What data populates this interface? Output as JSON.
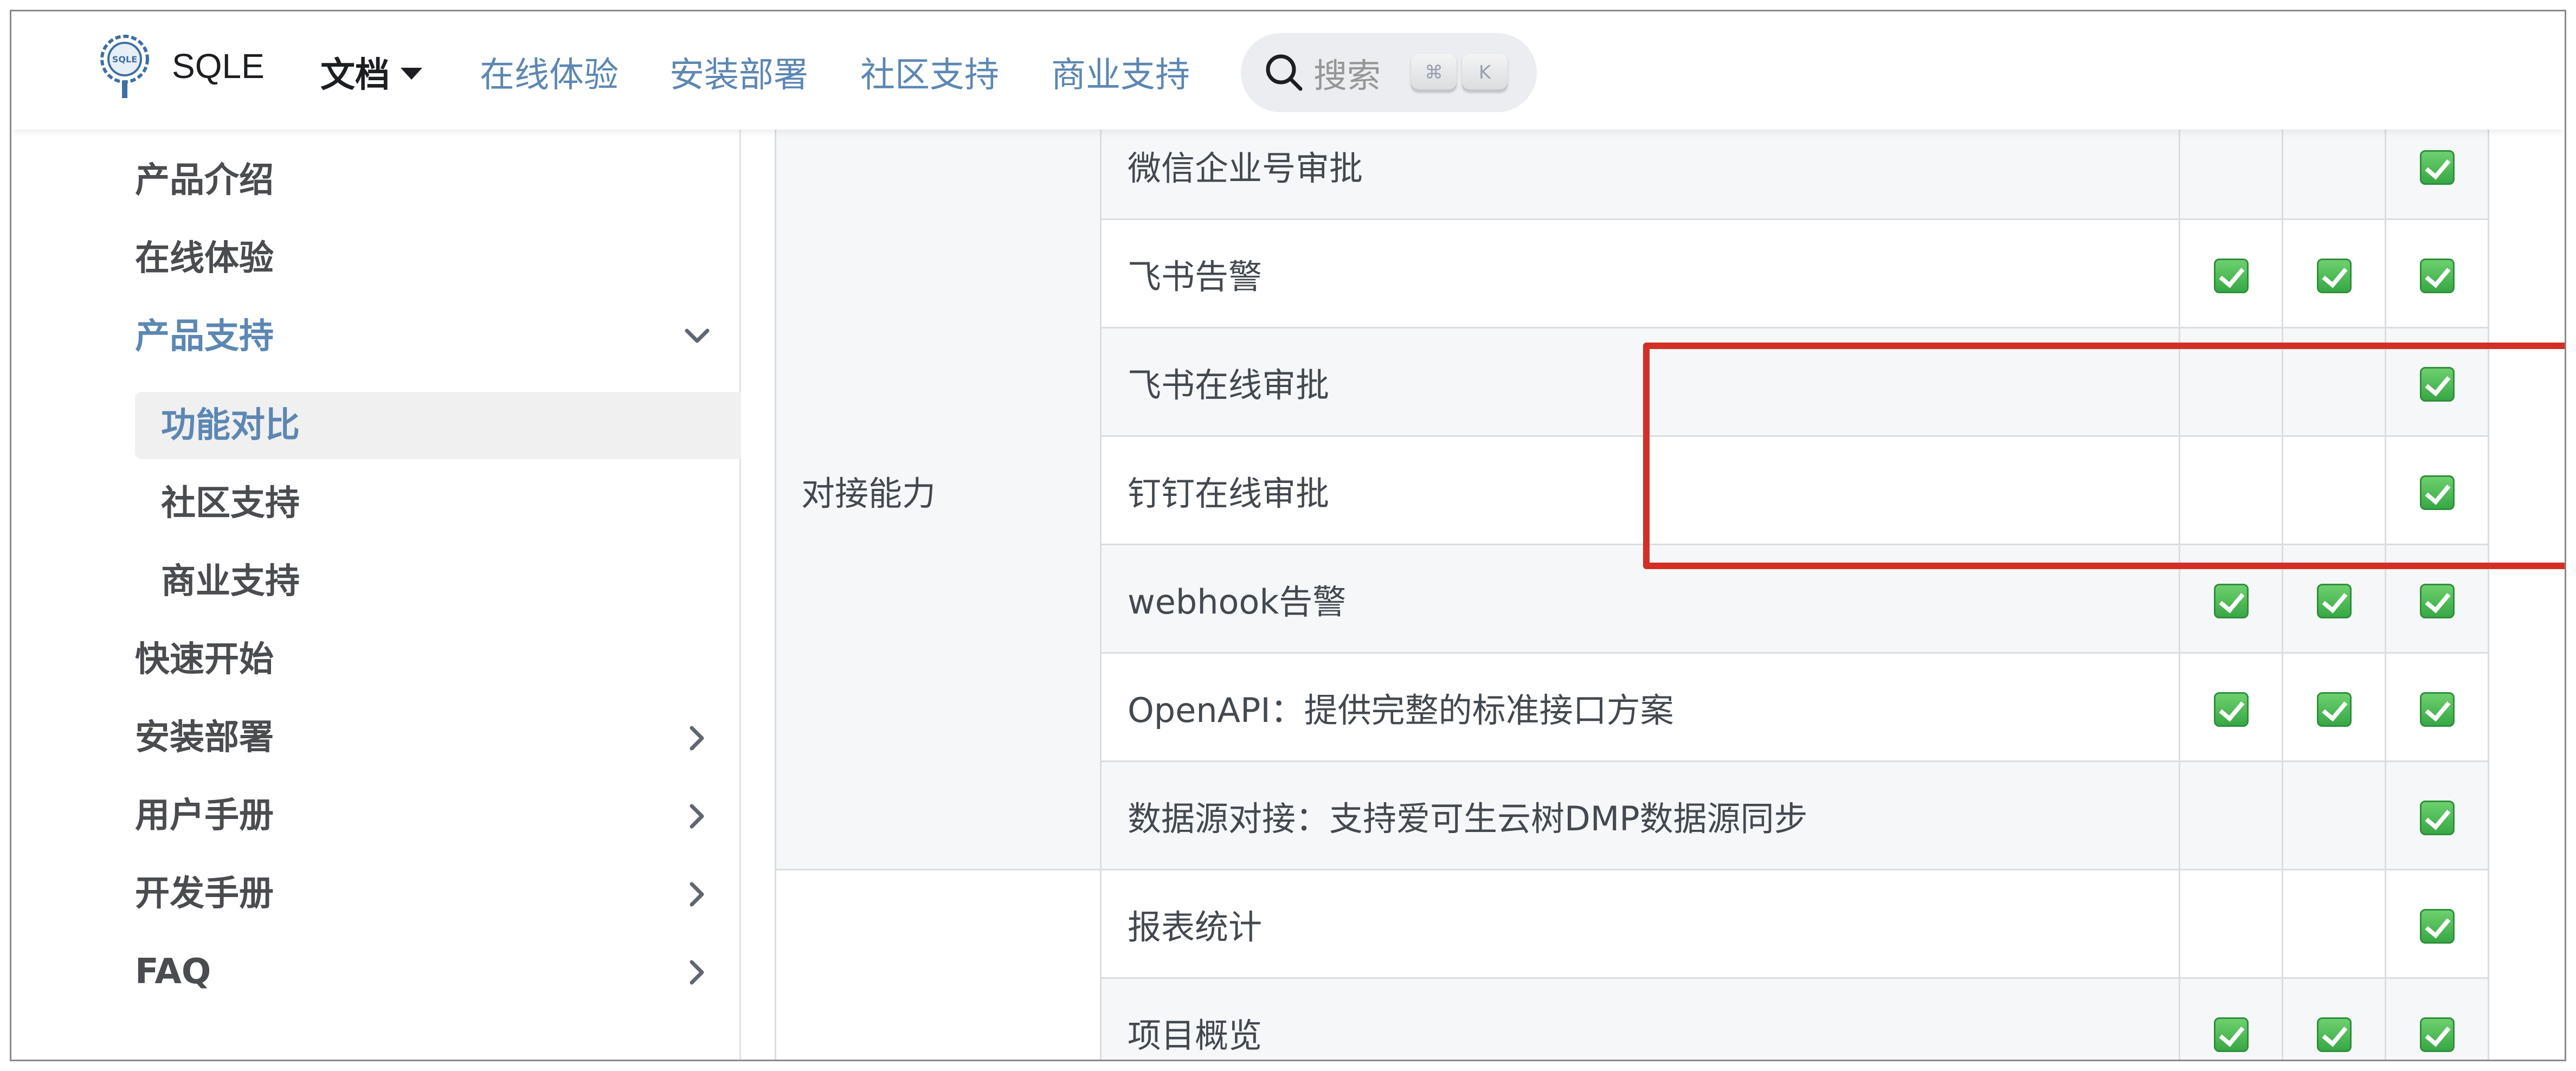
{
  "brand": {
    "name": "SQLE",
    "logo_text": "SQLE"
  },
  "navbar": {
    "docs_label": "文档",
    "links": [
      "在线体验",
      "安装部署",
      "社区支持",
      "商业支持"
    ],
    "search": {
      "label": "搜索",
      "key1": "⌘",
      "key2": "K"
    }
  },
  "sidebar": {
    "items": [
      {
        "label": "产品介绍"
      },
      {
        "label": "在线体验"
      },
      {
        "label": "产品支持"
      },
      {
        "label": "功能对比"
      },
      {
        "label": "社区支持"
      },
      {
        "label": "商业支持"
      },
      {
        "label": "快速开始"
      },
      {
        "label": "安装部署"
      },
      {
        "label": "用户手册"
      },
      {
        "label": "开发手册"
      },
      {
        "label": "FAQ"
      }
    ]
  },
  "table": {
    "group_label": "对接能力",
    "rows": [
      {
        "feature": "微信企业号审批",
        "checks": [
          false,
          false,
          true
        ]
      },
      {
        "feature": "飞书告警",
        "checks": [
          true,
          true,
          true
        ]
      },
      {
        "feature": "飞书在线审批",
        "checks": [
          false,
          false,
          true
        ]
      },
      {
        "feature": "钉钉在线审批",
        "checks": [
          false,
          false,
          true
        ]
      },
      {
        "feature": "webhook告警",
        "checks": [
          true,
          true,
          true
        ]
      },
      {
        "feature": "OpenAPI：提供完整的标准接口方案",
        "checks": [
          true,
          true,
          true
        ]
      },
      {
        "feature": "数据源对接：支持爱可生云树DMP数据源同步",
        "checks": [
          false,
          false,
          true
        ]
      },
      {
        "feature": "报表统计",
        "checks": [
          false,
          false,
          true
        ]
      },
      {
        "feature": "项目概览",
        "checks": [
          true,
          true,
          true
        ]
      }
    ]
  },
  "colors": {
    "accent": "#5c87b3",
    "highlight_border": "#d32f26",
    "check_green": "#37a845"
  }
}
